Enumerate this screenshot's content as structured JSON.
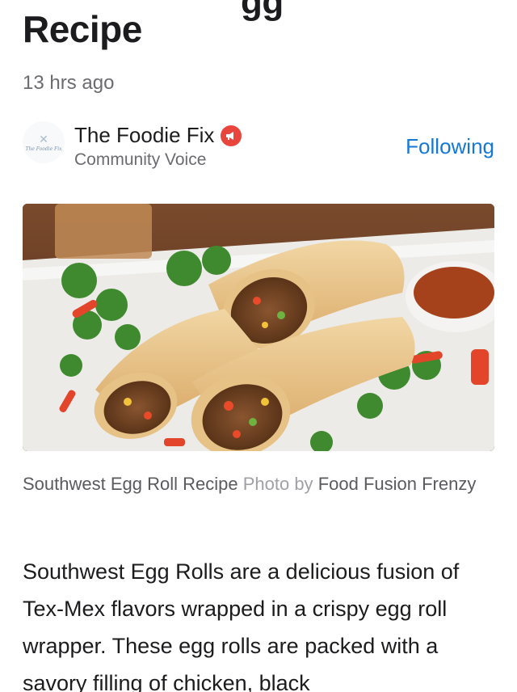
{
  "article": {
    "title_cut": "gg",
    "title": "Recipe",
    "time": "13 hrs ago"
  },
  "author": {
    "logo_text": "The Foodie Fix",
    "name": "The Foodie Fix",
    "subtitle": "Community Voice",
    "follow_label": "Following"
  },
  "photo": {
    "subject_icon": "egg-rolls-photo"
  },
  "caption": {
    "text": "Southwest Egg Roll Recipe",
    "photo_by": "Photo by",
    "credit": "Food Fusion Frenzy"
  },
  "body": {
    "paragraph": "Southwest Egg Rolls are a delicious fusion of Tex-Mex flavors wrapped in a crispy egg roll wrapper. These egg rolls are packed with a savory filling of chicken, black"
  },
  "colors": {
    "link_blue": "#1479d6",
    "badge_red": "#e8453c"
  }
}
